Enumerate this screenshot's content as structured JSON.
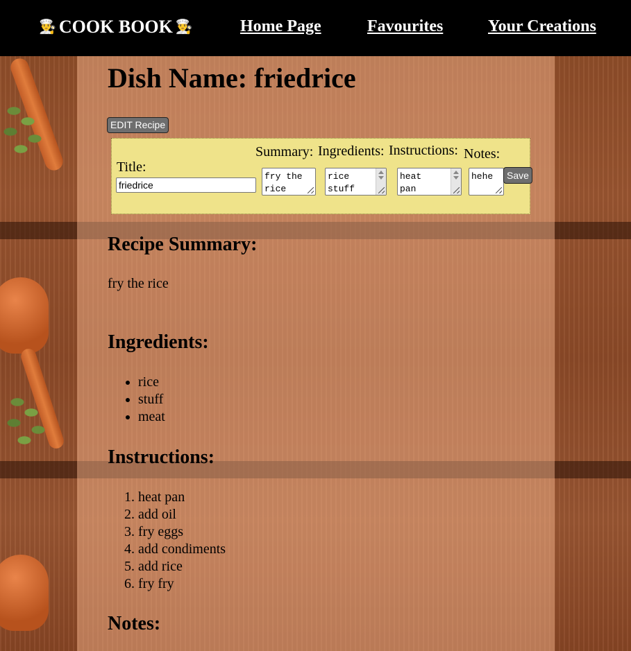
{
  "nav": {
    "brand": "COOK BOOK",
    "links": [
      "Home Page",
      "Favourites",
      "Your Creations"
    ]
  },
  "dish": {
    "label": "Dish Name:",
    "name": "friedrice"
  },
  "edit_button": "EDIT Recipe",
  "edit_form": {
    "title_label": "Title:",
    "title_value": "friedrice",
    "summary_label": "Summary:",
    "summary_value": "fry the\nrice",
    "ingredients_label": "Ingredients:",
    "ingredients_value": "rice\nstuff",
    "instructions_label": "Instructions:",
    "instructions_value": "heat\npan",
    "notes_label": "Notes:",
    "notes_value": "hehe",
    "save_label": "Save"
  },
  "sections": {
    "summary_heading": "Recipe Summary:",
    "summary_text": "fry the rice",
    "ingredients_heading": "Ingredients:",
    "ingredients": [
      "rice",
      "stuff",
      "meat"
    ],
    "instructions_heading": "Instructions:",
    "instructions": [
      "heat pan",
      "add oil",
      "fry eggs",
      "add condiments",
      "add rice",
      "fry fry"
    ],
    "notes_heading": "Notes:"
  },
  "icons": {
    "brand_left": "chef-icon",
    "brand_right": "chef-icon"
  },
  "colors": {
    "navbar": "#000000",
    "edit_panel": "#efe38a",
    "button": "#6e6e6e"
  }
}
